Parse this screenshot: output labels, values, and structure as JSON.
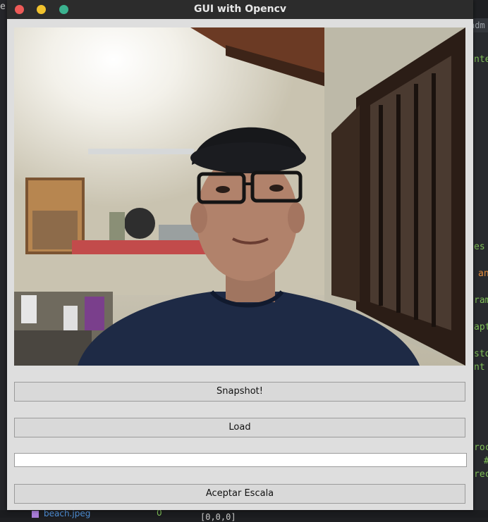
{
  "window": {
    "title": "GUI with Opencv"
  },
  "camera": {
    "icon": "webcam-live-preview-image"
  },
  "buttons": {
    "snapshot": "Snapshot!",
    "load": "Load",
    "aceptar": "Aceptar Escala"
  },
  "scale_entry": {
    "value": ""
  },
  "background": {
    "tab_text": "adm",
    "fragments": [
      "e",
      "nter",
      "es",
      "an",
      "rame",
      "apt",
      "sto",
      "nt",
      "roc",
      "#",
      "rec"
    ],
    "bottom_file": "beach.jpeg",
    "bottom_number": "0",
    "bottom_code": "[0,0,0]"
  },
  "colors": {
    "close": "#ed5a57",
    "minimize": "#f1c22d",
    "maximize": "#3bb28f",
    "titlebar": "#2c2c2c",
    "window_bg": "#dedede",
    "button_bg": "#d9d9d9"
  }
}
